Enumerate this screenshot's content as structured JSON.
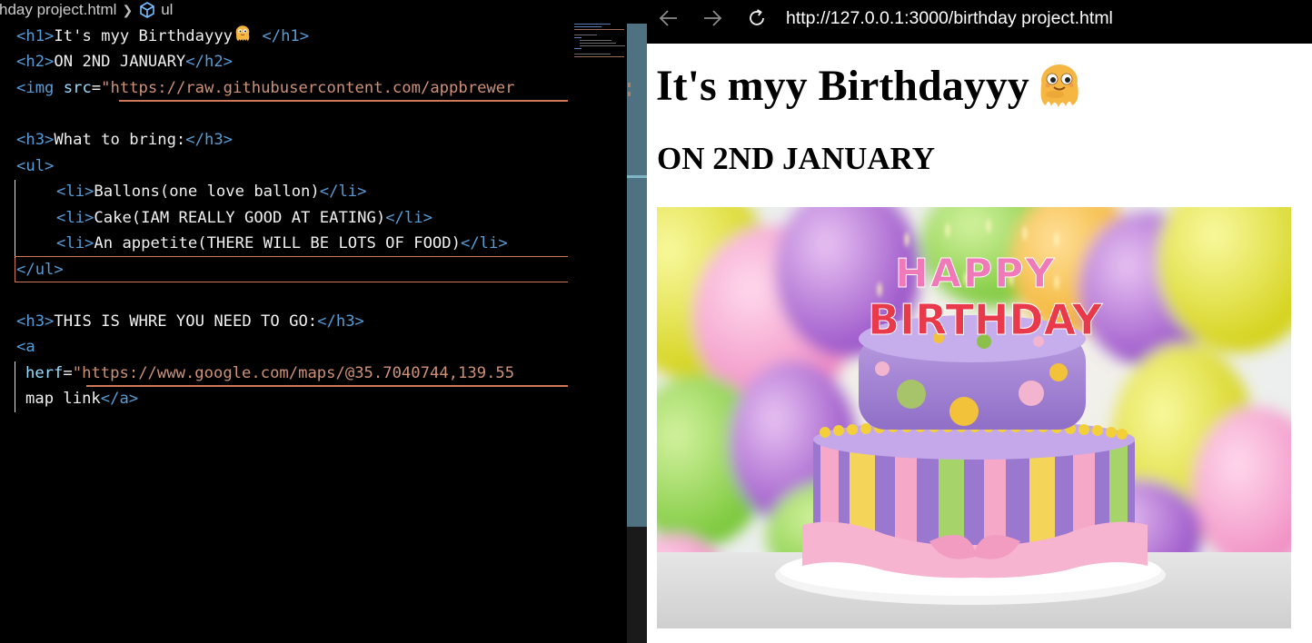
{
  "editor": {
    "breadcrumb": {
      "file": "hday project.html",
      "symbol": "ul"
    },
    "lines": {
      "l1": {
        "open": "<h1>",
        "text": "It's myy Birthdayyy",
        "close": "</h1>"
      },
      "l2": {
        "open": "<h2>",
        "text": "ON 2ND JANUARY",
        "close": "</h2>"
      },
      "l3": {
        "open": "<img ",
        "attr": "src",
        "eq": "=",
        "str": "\"https://raw.githubusercontent.com/appbrewer"
      },
      "l5": {
        "open": "<h3>",
        "text": "What to bring:",
        "close": "</h3>"
      },
      "l6": {
        "open": "<ul>"
      },
      "l7": {
        "open": "<li>",
        "text": "Ballons(one love ballon)",
        "close": "</li>"
      },
      "l8": {
        "open": "<li>",
        "text": "Cake(IAM REALLY GOOD AT EATING)",
        "close": "</li>"
      },
      "l9": {
        "open": "<li>",
        "text": "An appetite(THERE WILL BE LOTS OF FOOD)",
        "close": "</li>"
      },
      "l10": {
        "close": "</ul>"
      },
      "l12": {
        "open": "<h3>",
        "text": "THIS IS WHRE YOU NEED TO GO:",
        "close": "</h3>"
      },
      "l13": {
        "open": "<a"
      },
      "l14": {
        "attr": "herf",
        "eq": "=",
        "str": "\"https://www.google.com/maps/@35.7040744,139.55"
      },
      "l15": {
        "text": "map link",
        "close": "</a>"
      }
    }
  },
  "browser": {
    "url": "http://127.0.0.1:3000/birthday project.html",
    "page": {
      "h1": "It's myy Birthdayyy",
      "h2": "ON 2ND JANUARY",
      "cake_text_top": "HAPPY",
      "cake_text_bottom": "BIRTHDAY"
    }
  },
  "colors": {
    "tag": "#569cd6",
    "string": "#ce9178",
    "attribute": "#9cdcfe",
    "scrollbar": "#4f7282"
  },
  "icons": {
    "back": "arrow-left-icon",
    "forward": "arrow-right-icon",
    "reload": "reload-icon",
    "symbol": "cube-icon",
    "emoji": "octopus-emoji"
  }
}
